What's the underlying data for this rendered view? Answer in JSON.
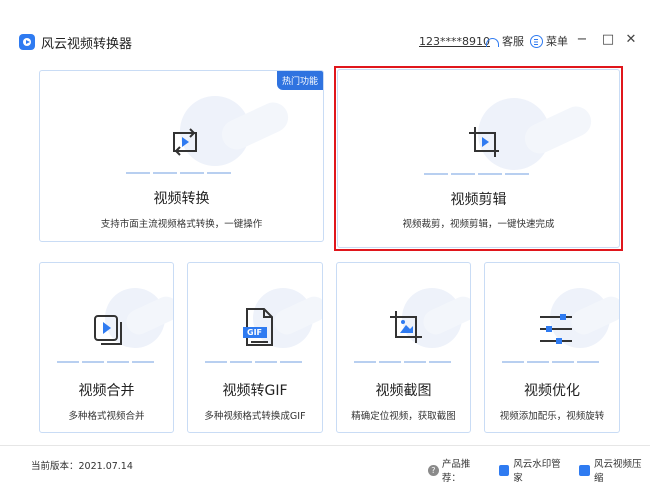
{
  "window": {
    "title": "风云视频转换器",
    "user_id": "123****8910",
    "support_label": "客服",
    "menu_label": "菜单",
    "minimize": "−",
    "maximize": "□",
    "close": "✕"
  },
  "cards": {
    "convert": {
      "title": "视频转换",
      "desc": "支持市面主流视频格式转换，一键操作",
      "badge": "热门功能",
      "icon": "convert-icon"
    },
    "edit": {
      "title": "视频剪辑",
      "desc": "视频裁剪，视频剪辑，一键快速完成",
      "icon": "crop-play-icon",
      "selected": true
    },
    "merge": {
      "title": "视频合并",
      "desc": "多种格式视频合并",
      "icon": "merge-icon"
    },
    "gif": {
      "title": "视频转GIF",
      "desc": "多种视频格式转换成GIF",
      "icon": "gif-file-icon",
      "icon_text": "GIF"
    },
    "screenshot": {
      "title": "视频截图",
      "desc": "精确定位视频，获取截图",
      "icon": "crop-image-icon"
    },
    "optimize": {
      "title": "视频优化",
      "desc": "视频添加配乐，视频旋转",
      "icon": "sliders-icon"
    }
  },
  "footer": {
    "version": "当前版本：2021.07.14",
    "recommend_label": "产品推荐：",
    "products": [
      "风云水印管家",
      "风云视频压缩"
    ]
  },
  "colors": {
    "accent": "#2f7bf1",
    "selected_border": "#e0161c",
    "card_border": "#c9dcf5"
  }
}
